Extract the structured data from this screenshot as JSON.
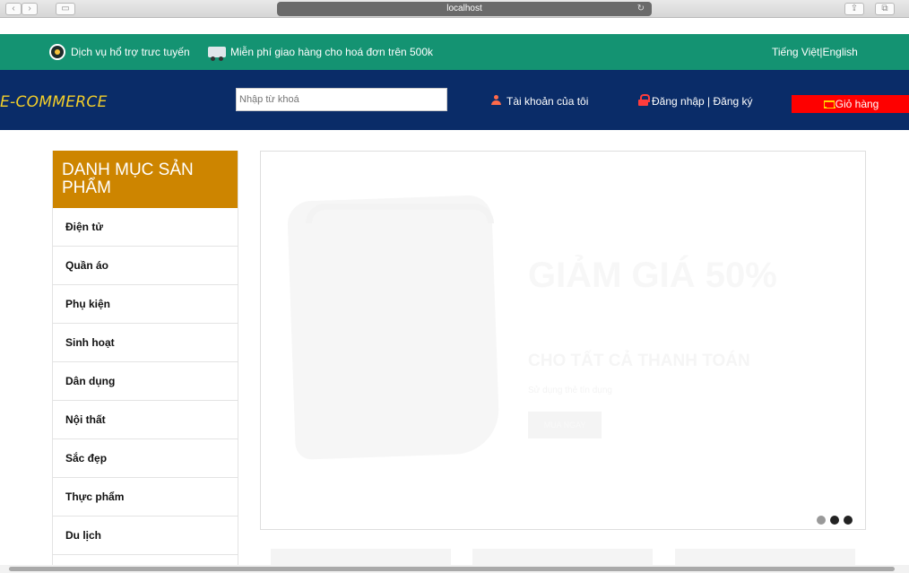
{
  "browser": {
    "url": "localhost",
    "back": "‹",
    "forward": "›",
    "sidebar_toggle": "▭",
    "reload": "↻",
    "share": "⇪",
    "tabs": "⧉"
  },
  "topbar": {
    "support_text": "Dịch vụ hổ trợ trưc tuyến",
    "shipping_text": "Miễn phí giao hàng cho hoá đơn trên 500k",
    "language": "Tiếng Việt|English"
  },
  "header": {
    "logo": "E-COMMERCE",
    "search_placeholder": "Nhập từ khoá",
    "account": "Tài khoản của tôi",
    "login_register": "Đăng nhập | Đăng ký",
    "cart": "Giỏ hàng"
  },
  "sidebar": {
    "title": "DANH MỤC SẢN PHẨM",
    "items": [
      {
        "label": "Điện tử"
      },
      {
        "label": "Quần áo"
      },
      {
        "label": "Phụ kiện"
      },
      {
        "label": "Sinh hoạt"
      },
      {
        "label": "Dân dụng"
      },
      {
        "label": "Nội thất"
      },
      {
        "label": "Sắc đẹp"
      },
      {
        "label": "Thực phẩm"
      },
      {
        "label": "Du lịch"
      }
    ]
  },
  "slider": {
    "title": "GIẢM GIÁ 50%",
    "subtitle": "CHO TẤT CẢ THANH TOÁN",
    "description": "Sử dụng thẻ tín dụng",
    "button": "MUA NGAY",
    "active_slide": 1,
    "total_slides": 3
  },
  "colors": {
    "topbar": "#149372",
    "header": "#0a2c68",
    "logo": "#f2ce2a",
    "sidebar_title": "#cd8500",
    "cart": "#fe0000"
  },
  "icons": {
    "support": "headset-icon",
    "shipping": "truck-icon",
    "account": "user-icon",
    "login": "lock-icon",
    "cart": "cart-icon"
  }
}
